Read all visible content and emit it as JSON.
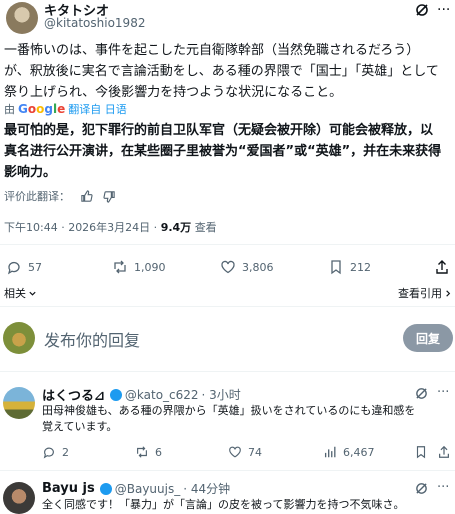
{
  "colors": {
    "accent": "#1d9bf0",
    "muted": "#536471",
    "text": "#0f1419",
    "reply_button": "#8b98a5"
  },
  "main_post": {
    "name": "キタトシオ",
    "handle": "@kitatoshio1982",
    "text_ja_line1": "一番怖いのは、事件を起こした元自衛隊幹部（当然免職されるだろう）",
    "text_ja_line2": "が、釈放後に実名で言論活動をし、ある種の界隈で「国士」「英雄」として",
    "text_ja_line3": "祭り上げられ、今後影響力を持つような状況になること。",
    "translated_by_prefix": "由",
    "translated_by_google": "Google",
    "translated_from": "翻译自 日语",
    "translated_line1": "最可怕的是，犯下罪行的前自卫队军官（无疑会被开除）可能会被释放，以",
    "translated_line2": "真名进行公开演讲，在某些圈子里被誉为“爱国者”或“英雄”，并在未来获得",
    "translated_line3": "影响力。",
    "rate_translation": "评价此翻译：",
    "timestamp": "下午10:44 · 2026年3月24日 ·",
    "views_count": "9.4万",
    "views_label": "查看",
    "replies": "57",
    "reposts": "1,090",
    "likes": "3,806",
    "bookmarks": "212",
    "related": "相关",
    "view_quotes": "查看引用"
  },
  "composer": {
    "placeholder": "发布你的回复",
    "reply_button": "回复"
  },
  "replies": [
    {
      "name": "はくつる⊿",
      "handle": "@kato_c622",
      "time": "· 3小时",
      "text_line1": "田母神俊雄も、ある種の界隈から「英雄」扱いをされているのにも違和感を",
      "text_line2": "覚えています。",
      "replies": "2",
      "reposts": "6",
      "likes": "74",
      "views": "6,467"
    },
    {
      "name": "Bayu js",
      "handle": "@Bayuujs_",
      "time": "· 44分钟",
      "text_line1": "全く同感です！「暴力」が「言論」の皮を被って影響力を持つ不気味さ。"
    }
  ]
}
